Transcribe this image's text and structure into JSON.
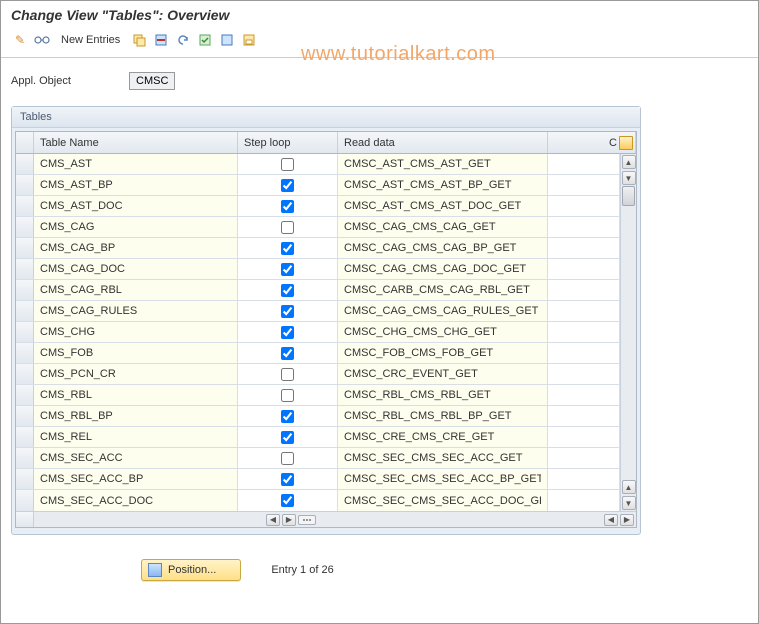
{
  "title": "Change View \"Tables\": Overview",
  "toolbar": {
    "new_entries": "New Entries"
  },
  "watermark": "www.tutorialkart.com",
  "appl_object_label": "Appl. Object",
  "appl_object_value": "CMSC",
  "panel_title": "Tables",
  "columns": {
    "c0": "",
    "c1": "Table Name",
    "c2": "Step loop",
    "c3": "Read data",
    "c4": "C"
  },
  "rows": [
    {
      "name": "CMS_AST",
      "step": false,
      "read": "CMSC_AST_CMS_AST_GET"
    },
    {
      "name": "CMS_AST_BP",
      "step": true,
      "read": "CMSC_AST_CMS_AST_BP_GET"
    },
    {
      "name": "CMS_AST_DOC",
      "step": true,
      "read": "CMSC_AST_CMS_AST_DOC_GET"
    },
    {
      "name": "CMS_CAG",
      "step": false,
      "read": "CMSC_CAG_CMS_CAG_GET"
    },
    {
      "name": "CMS_CAG_BP",
      "step": true,
      "read": "CMSC_CAG_CMS_CAG_BP_GET"
    },
    {
      "name": "CMS_CAG_DOC",
      "step": true,
      "read": "CMSC_CAG_CMS_CAG_DOC_GET"
    },
    {
      "name": "CMS_CAG_RBL",
      "step": true,
      "read": "CMSC_CARB_CMS_CAG_RBL_GET"
    },
    {
      "name": "CMS_CAG_RULES",
      "step": true,
      "read": "CMSC_CAG_CMS_CAG_RULES_GET"
    },
    {
      "name": "CMS_CHG",
      "step": true,
      "read": "CMSC_CHG_CMS_CHG_GET"
    },
    {
      "name": "CMS_FOB",
      "step": true,
      "read": "CMSC_FOB_CMS_FOB_GET"
    },
    {
      "name": "CMS_PCN_CR",
      "step": false,
      "read": "CMSC_CRC_EVENT_GET"
    },
    {
      "name": "CMS_RBL",
      "step": false,
      "read": "CMSC_RBL_CMS_RBL_GET"
    },
    {
      "name": "CMS_RBL_BP",
      "step": true,
      "read": "CMSC_RBL_CMS_RBL_BP_GET"
    },
    {
      "name": "CMS_REL",
      "step": true,
      "read": "CMSC_CRE_CMS_CRE_GET"
    },
    {
      "name": "CMS_SEC_ACC",
      "step": false,
      "read": "CMSC_SEC_CMS_SEC_ACC_GET"
    },
    {
      "name": "CMS_SEC_ACC_BP",
      "step": true,
      "read": "CMSC_SEC_CMS_SEC_ACC_BP_GET"
    },
    {
      "name": "CMS_SEC_ACC_DOC",
      "step": true,
      "read": "CMSC_SEC_CMS_SEC_ACC_DOC_GET"
    }
  ],
  "position_label": "Position...",
  "entry_text": "Entry 1 of 26"
}
